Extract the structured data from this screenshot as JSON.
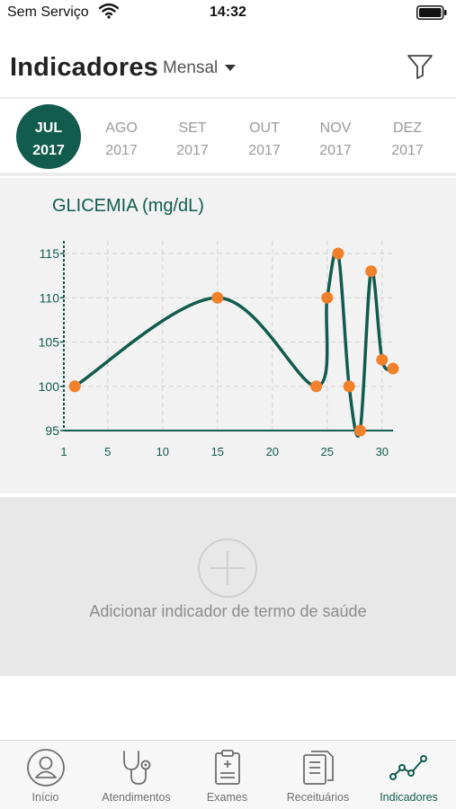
{
  "status_bar": {
    "carrier": "Sem Serviço",
    "time": "14:32"
  },
  "header": {
    "title": "Indicadores",
    "period": "Mensal"
  },
  "months": [
    {
      "month": "JUL",
      "year": "2017",
      "selected": true
    },
    {
      "month": "AGO",
      "year": "2017",
      "selected": false
    },
    {
      "month": "SET",
      "year": "2017",
      "selected": false
    },
    {
      "month": "OUT",
      "year": "2017",
      "selected": false
    },
    {
      "month": "NOV",
      "year": "2017",
      "selected": false
    },
    {
      "month": "DEZ",
      "year": "2017",
      "selected": false
    }
  ],
  "chart_data": {
    "type": "line",
    "title": "GLICEMIA (mg/dL)",
    "xlabel": "",
    "ylabel": "",
    "x_ticks": [
      1,
      5,
      10,
      15,
      20,
      25,
      30
    ],
    "y_ticks": [
      95,
      100,
      105,
      110,
      115
    ],
    "xlim": [
      1,
      31
    ],
    "ylim": [
      95,
      115
    ],
    "grid": true,
    "legend": "none",
    "colors": {
      "line": "#115c4d",
      "points": "#f0802a",
      "grid": "#cfcfcf",
      "axis": "#115c4d"
    },
    "points": [
      {
        "x": 2,
        "y": 100
      },
      {
        "x": 15,
        "y": 110
      },
      {
        "x": 24,
        "y": 100
      },
      {
        "x": 25,
        "y": 110
      },
      {
        "x": 26,
        "y": 115
      },
      {
        "x": 27,
        "y": 100
      },
      {
        "x": 28,
        "y": 95
      },
      {
        "x": 29,
        "y": 113
      },
      {
        "x": 30,
        "y": 103
      },
      {
        "x": 31,
        "y": 102
      }
    ]
  },
  "add_indicator": {
    "label": "Adicionar indicador de termo de saúde"
  },
  "tabs": [
    {
      "label": "Início",
      "icon": "profile-icon",
      "active": false
    },
    {
      "label": "Atendimentos",
      "icon": "stethoscope-icon",
      "active": false
    },
    {
      "label": "Exames",
      "icon": "clipboard-icon",
      "active": false
    },
    {
      "label": "Receituários",
      "icon": "prescriptions-icon",
      "active": false
    },
    {
      "label": "Indicadores",
      "icon": "line-chart-icon",
      "active": true
    }
  ]
}
